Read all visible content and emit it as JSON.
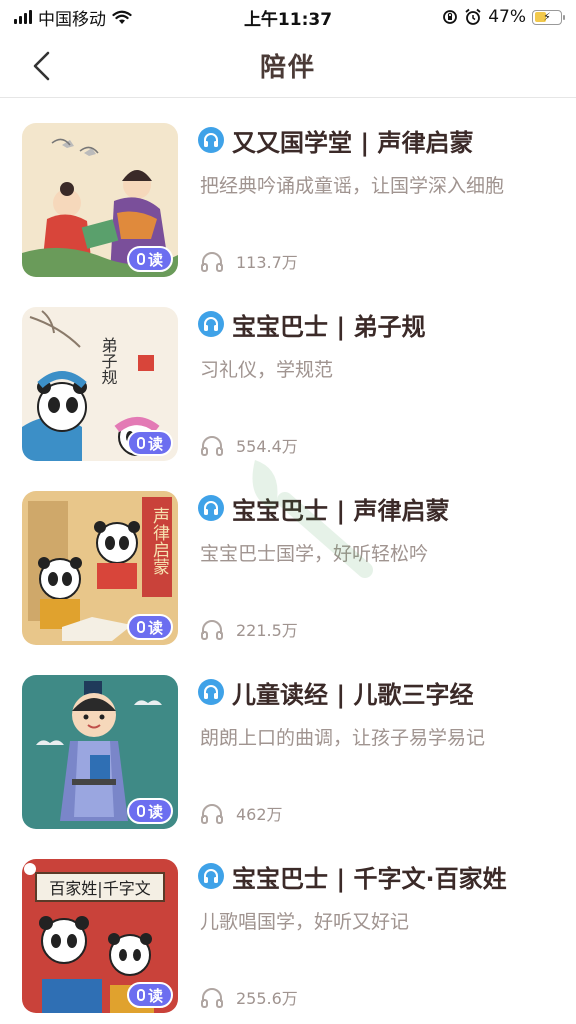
{
  "status_bar": {
    "carrier": "中国移动",
    "time": "上午11:37",
    "battery": "47%",
    "battery_level": 0.47
  },
  "nav": {
    "title": "陪伴"
  },
  "read_badge": "读",
  "items": [
    {
      "title": "又又国学堂 | 声律启蒙",
      "subtitle": "把经典吟诵成童谣，让国学深入细胞",
      "plays": "113.7万"
    },
    {
      "title": "宝宝巴士 | 弟子规",
      "subtitle": "习礼仪，学规范",
      "plays": "554.4万"
    },
    {
      "title": "宝宝巴士 | 声律启蒙",
      "subtitle": "宝宝巴士国学，好听轻松吟",
      "plays": "221.5万"
    },
    {
      "title": "儿童读经 | 儿歌三字经",
      "subtitle": "朗朗上口的曲调，让孩子易学易记",
      "plays": "462万"
    },
    {
      "title": "宝宝巴士 | 千字文·百家姓",
      "subtitle": "儿歌唱国学，好听又好记",
      "plays": "255.6万"
    }
  ],
  "cover_texts": {
    "dizigui": "弟子规",
    "shenglv": "声律启蒙",
    "baijiaxing": "百家姓|千字文"
  },
  "colors": {
    "accent_blue": "#3fa2e8",
    "badge_purple": "#6c6ef0",
    "title_brown": "#3b2a28",
    "subtitle_gray": "#a09490"
  }
}
